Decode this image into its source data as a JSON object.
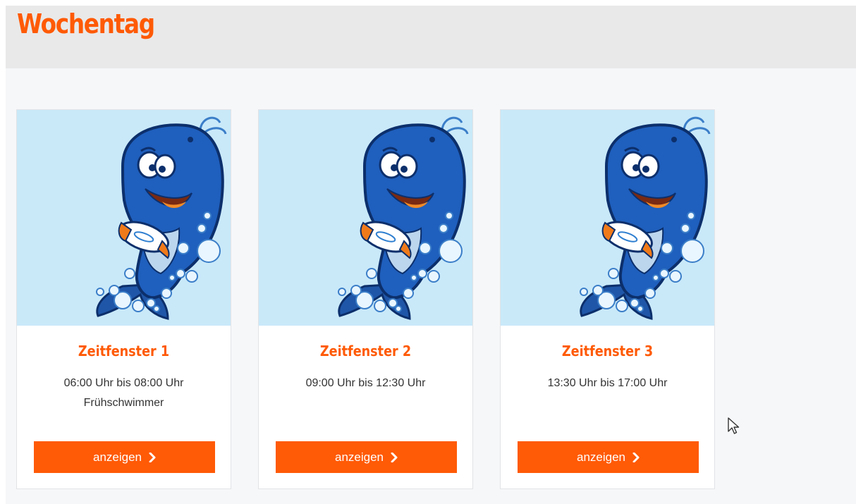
{
  "page": {
    "title": "Wochentag"
  },
  "colors": {
    "accent": "#fe5a06",
    "card_image_bg": "#c9e9f9",
    "header_bg": "#e9e9e9"
  },
  "cards": [
    {
      "title": "Zeitfenster 1",
      "line1": "06:00 Uhr bis 08:00 Uhr",
      "line2": "Frühschwimmer",
      "button_label": "anzeigen",
      "image_icon": "whale-mascot-icon"
    },
    {
      "title": "Zeitfenster 2",
      "line1": "09:00 Uhr bis 12:30 Uhr",
      "line2": "",
      "button_label": "anzeigen",
      "image_icon": "whale-mascot-icon"
    },
    {
      "title": "Zeitfenster 3",
      "line1": "13:30 Uhr bis 17:00 Uhr",
      "line2": "",
      "button_label": "anzeigen",
      "image_icon": "whale-mascot-icon"
    }
  ]
}
